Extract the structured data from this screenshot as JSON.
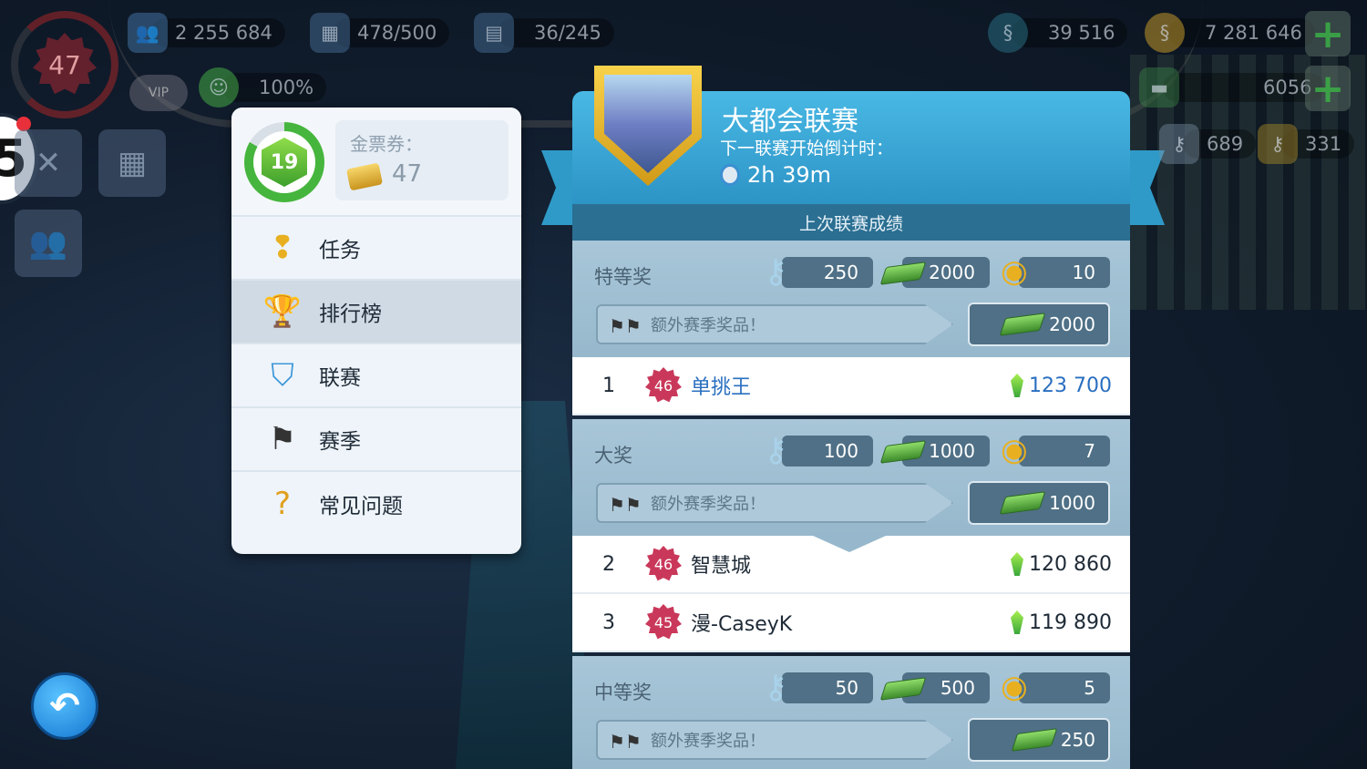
{
  "hud": {
    "level": "47",
    "population": "2 255 684",
    "storage": "478/500",
    "vehicles": "36/245",
    "happiness": "100%",
    "simcash": "39 516",
    "coins": "7 281 646",
    "cash_small": "6056",
    "keys_a": "689",
    "keys_b": "331",
    "vip_label": "VIP",
    "notif_number": "5"
  },
  "menu": {
    "level": "19",
    "ticket_label": "金票券：",
    "ticket_value": "47",
    "items": [
      {
        "label": "任务",
        "icon": "quest-icon"
      },
      {
        "label": "排行榜",
        "icon": "trophy-icon"
      },
      {
        "label": "联赛",
        "icon": "league-shield-icon"
      },
      {
        "label": "赛季",
        "icon": "checkered-flag-icon"
      },
      {
        "label": "常见问题",
        "icon": "help-book-icon"
      }
    ]
  },
  "league": {
    "title": "大都会联赛",
    "countdown_label": "下一联赛开始倒计时：",
    "countdown": "2h 39m",
    "section_title": "上次联赛成绩",
    "bonus_label": "额外赛季奖品！",
    "tiers": [
      {
        "name": "特等奖",
        "keys": "250",
        "cash": "2000",
        "medals": "10",
        "bonus": "2000"
      },
      {
        "name": "大奖",
        "keys": "100",
        "cash": "1000",
        "medals": "7",
        "bonus": "1000"
      },
      {
        "name": "中等奖",
        "keys": "50",
        "cash": "500",
        "medals": "5",
        "bonus": "250"
      }
    ],
    "ranks": [
      {
        "rank": "1",
        "level": "46",
        "name": "单挑王",
        "score": "123 700"
      },
      {
        "rank": "2",
        "level": "46",
        "name": "智慧城",
        "score": "120 860"
      },
      {
        "rank": "3",
        "level": "45",
        "name": "漫-CaseyK",
        "score": "119 890"
      }
    ]
  },
  "colors": {
    "accent_blue": "#2d94c6",
    "league_gold": "#f8d24b",
    "rank_badge": "#c9385a",
    "level_green": "#46b53d"
  }
}
